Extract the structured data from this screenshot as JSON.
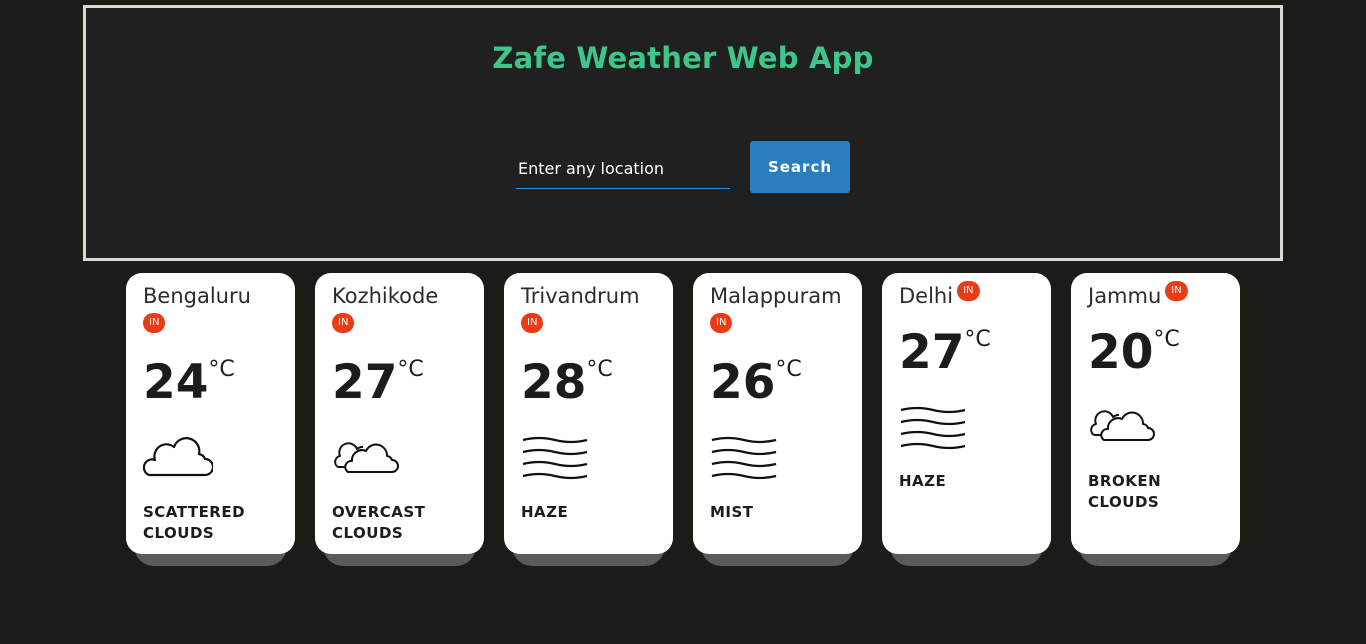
{
  "app": {
    "title": "Zafe Weather Web App"
  },
  "search": {
    "placeholder": "Enter any location",
    "button_label": "Search"
  },
  "cards": [
    {
      "city": "Bengaluru",
      "country": "IN",
      "temp": "24",
      "unit": "°C",
      "condition": "SCATTERED CLOUDS",
      "icon": "cloud-icon"
    },
    {
      "city": "Kozhikode",
      "country": "IN",
      "temp": "27",
      "unit": "°C",
      "condition": "OVERCAST CLOUDS",
      "icon": "overcast-clouds-icon"
    },
    {
      "city": "Trivandrum",
      "country": "IN",
      "temp": "28",
      "unit": "°C",
      "condition": "HAZE",
      "icon": "haze-icon"
    },
    {
      "city": "Malappuram",
      "country": "IN",
      "temp": "26",
      "unit": "°C",
      "condition": "MIST",
      "icon": "mist-icon"
    },
    {
      "city": "Delhi",
      "country": "IN",
      "temp": "27",
      "unit": "°C",
      "condition": "HAZE",
      "icon": "haze-icon"
    },
    {
      "city": "Jammu",
      "country": "IN",
      "temp": "20",
      "unit": "°C",
      "condition": "BROKEN CLOUDS",
      "icon": "broken-clouds-icon"
    }
  ],
  "colors": {
    "background": "#1b1b18",
    "header_bg": "#202020",
    "title": "#3ec78a",
    "button": "#2b7ebd",
    "badge": "#ea3c14"
  }
}
